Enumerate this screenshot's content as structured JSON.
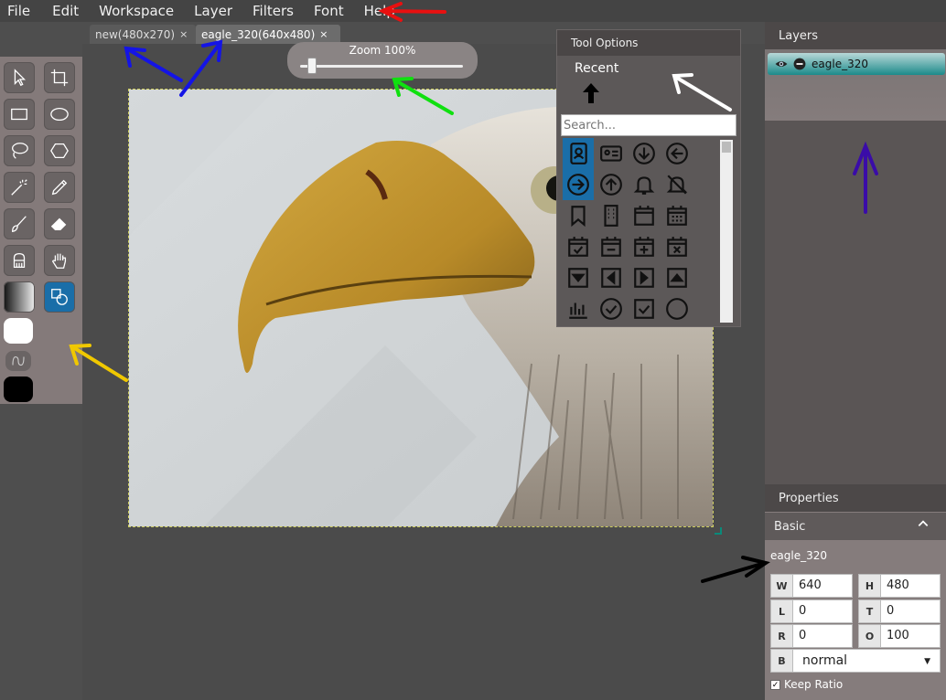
{
  "menu": [
    "File",
    "Edit",
    "Workspace",
    "Layer",
    "Filters",
    "Font",
    "Help"
  ],
  "tabs": [
    {
      "label": "new(480x270)",
      "close": "×"
    },
    {
      "label": "eagle_320(640x480)",
      "close": "×"
    }
  ],
  "zoom": {
    "label": "Zoom 100%",
    "level": 0.1
  },
  "tool_options": {
    "title": "Tool Options",
    "recent_label": "Recent",
    "search_placeholder": "Search...",
    "icons": [
      "address-book-icon",
      "id-card-icon",
      "arrow-circle-down-icon",
      "arrow-circle-left-icon",
      "arrow-circle-right-icon",
      "arrow-circle-up-icon",
      "bell-icon",
      "bell-slash-icon",
      "bookmark-icon",
      "building-icon",
      "calendar-icon",
      "calendar-grid-icon",
      "calendar-check-icon",
      "calendar-minus-icon",
      "calendar-plus-icon",
      "calendar-x-icon",
      "caret-down-icon",
      "caret-left-icon",
      "caret-right-icon",
      "caret-up-icon",
      "bar-chart-icon",
      "check-circle-icon",
      "check-square-icon",
      "circle-icon"
    ]
  },
  "layers": {
    "title": "Layers",
    "items": [
      {
        "name": "eagle_320",
        "visible": true
      }
    ]
  },
  "properties": {
    "title": "Properties",
    "section": "Basic",
    "layer_name": "eagle_320",
    "W": "640",
    "H": "480",
    "L": "0",
    "T": "0",
    "R": "0",
    "O": "100",
    "blend_label": "B",
    "blend_mode": "normal",
    "keep_ratio_label": "Keep Ratio",
    "keep_ratio": true
  },
  "toolbox": {
    "tools": [
      "select-tool",
      "crop-tool",
      "rectangle-tool",
      "ellipse-tool",
      "lasso-tool",
      "polygon-tool",
      "magic-wand-tool",
      "eyedropper-tool",
      "brush-tool",
      "eraser-tool",
      "stamp-tool",
      "hand-tool",
      "gradient-tool",
      "shape-tool"
    ],
    "active": "shape-tool",
    "foreground_color": "#ffffff",
    "background_color": "#000000"
  },
  "annotation_colors": {
    "red": "#e81010",
    "blue": "#1414e6",
    "green": "#10e010",
    "white": "#ffffff",
    "navy": "#3a0ca8",
    "yellow": "#f0c800",
    "black": "#000000"
  }
}
